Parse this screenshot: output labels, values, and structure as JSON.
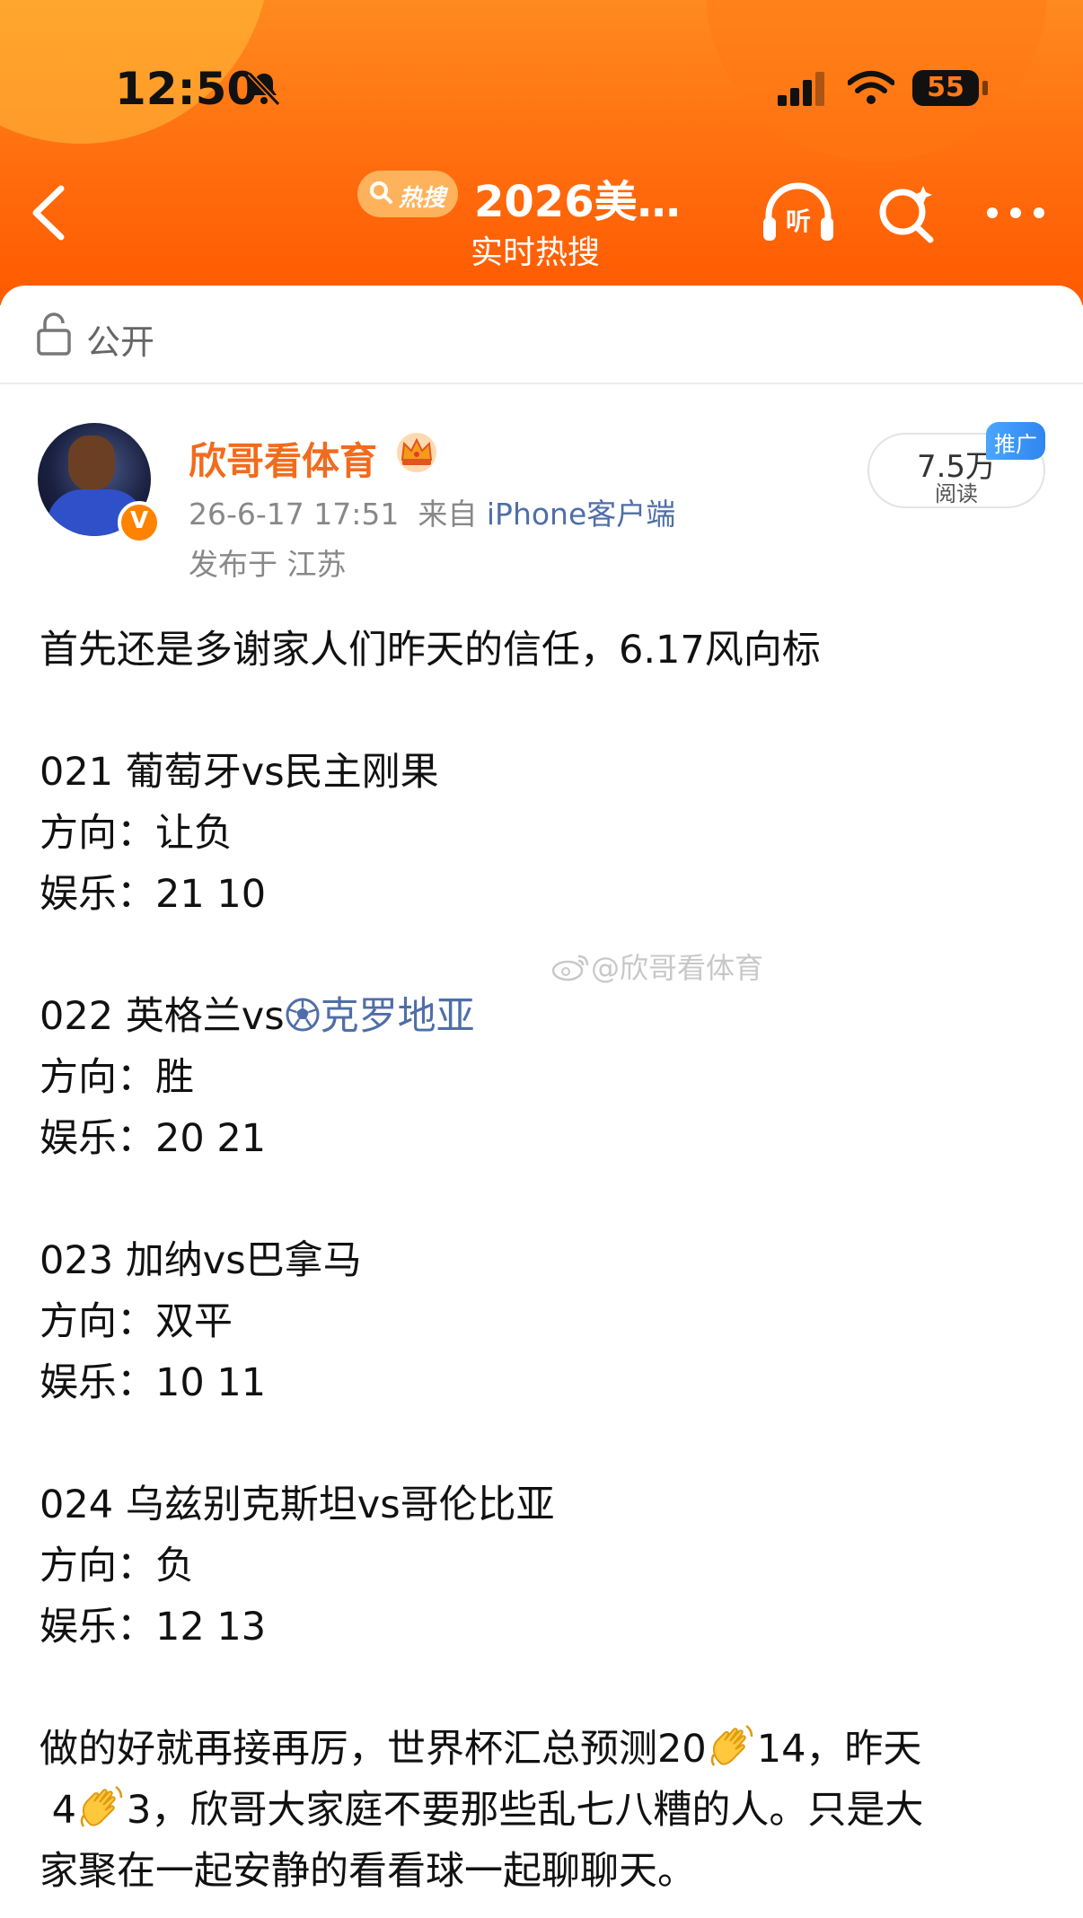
{
  "status_bar": {
    "time": "12:50",
    "battery": "55"
  },
  "nav": {
    "badge_label": "热搜",
    "title": "2026美…",
    "subtitle": "实时热搜"
  },
  "visibility": {
    "label": "公开"
  },
  "author": {
    "name": "欣哥看体育",
    "timestamp": "26-6-17 17:51",
    "source_prefix": "来自",
    "source": "iPhone客户端",
    "location": "发布于 江苏"
  },
  "stats": {
    "reads": "7.5万",
    "reads_label": "阅读",
    "promo_tag": "推广"
  },
  "post": {
    "intro": "首先还是多谢家人们昨天的信任，6.17风向标",
    "matches": [
      {
        "title": "021 葡萄牙vs民主刚果",
        "direction": "方向：让负",
        "fun": "娱乐：21 10"
      },
      {
        "title_prefix": "022 英格兰vs",
        "title_topic": "克罗地亚",
        "direction": "方向：胜",
        "fun": "娱乐：20 21"
      },
      {
        "title": "023 加纳vs巴拿马",
        "direction": "方向：双平",
        "fun": "娱乐：10 11"
      },
      {
        "title": "024 乌兹别克斯坦vs哥伦比亚",
        "direction": "方向：负",
        "fun": "娱乐：12 13"
      }
    ],
    "closing_1": "做的好就再接再厉，世界杯汇总预测20",
    "closing_2": "14，昨天",
    "closing_3": "4",
    "closing_4": "3，欣哥大家庭不要那些乱七八糟的人。只是大",
    "closing_5": "家聚在一起安静的看看球一起聊聊天。"
  },
  "watermark": "@欣哥看体育",
  "colors": {
    "brand_orange": "#ff6a0d",
    "username": "#f26b1d",
    "link_blue": "#4f6ea8"
  }
}
